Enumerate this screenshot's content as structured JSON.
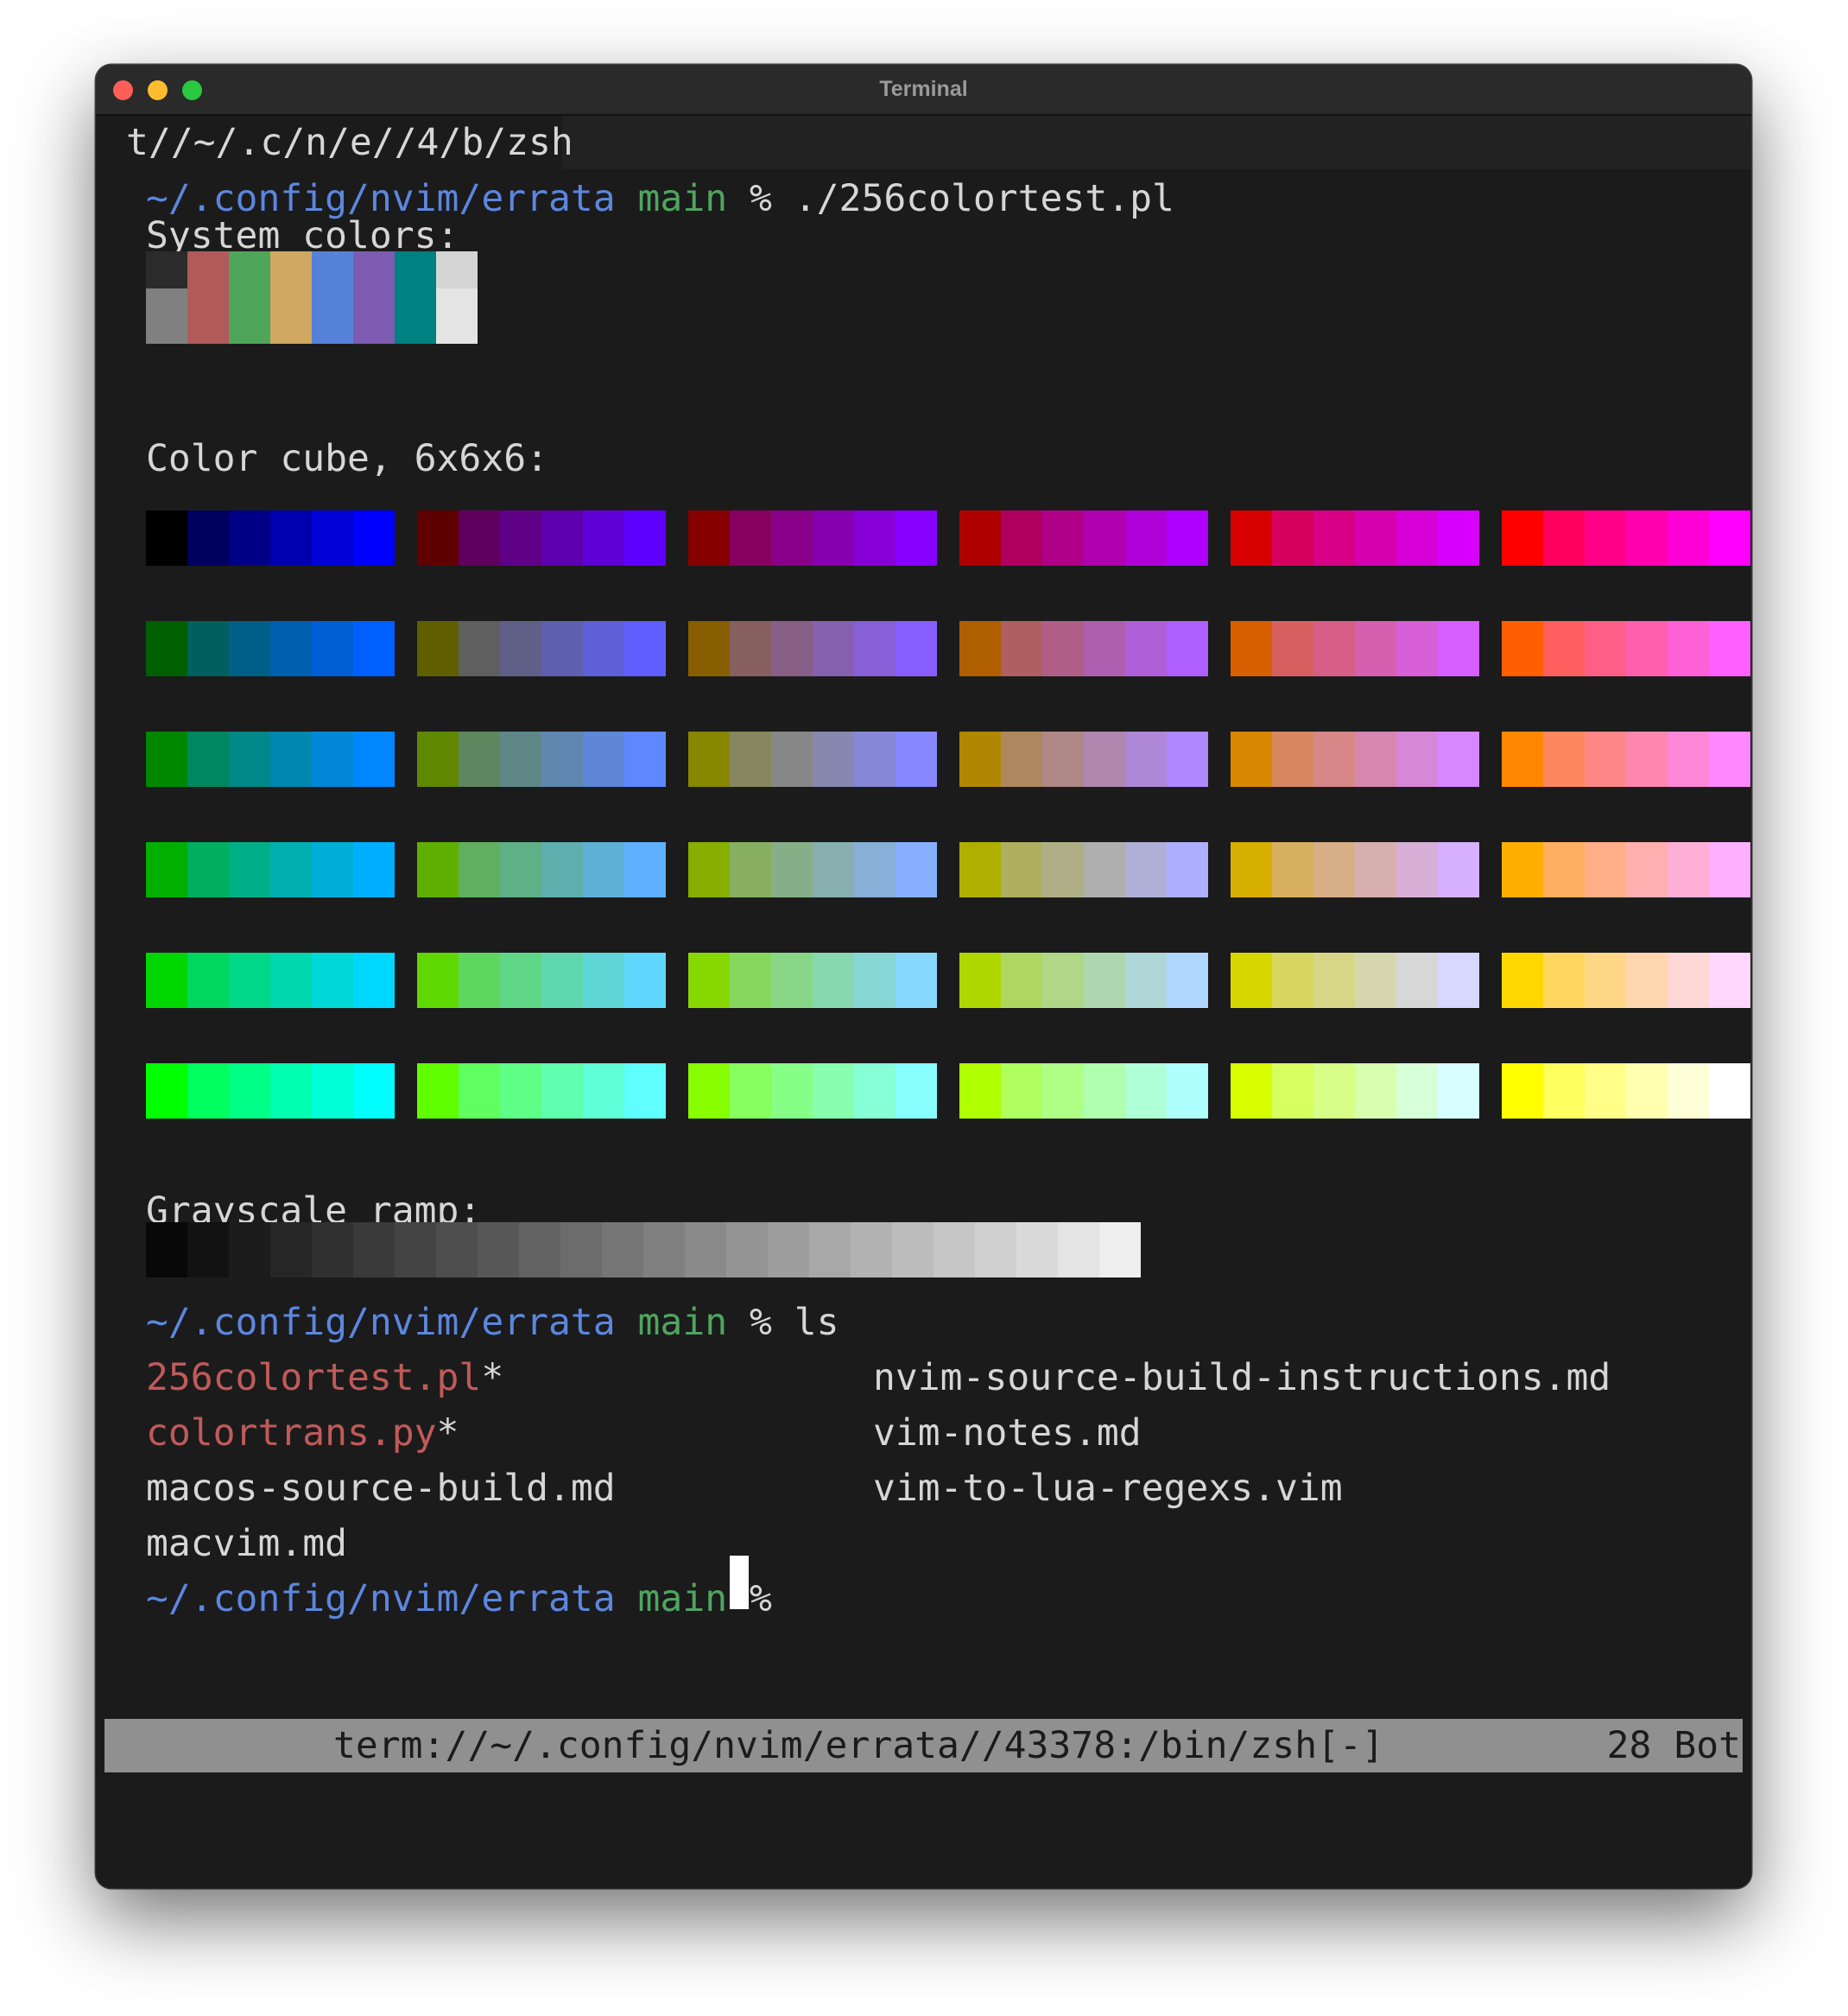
{
  "window": {
    "title": "Terminal"
  },
  "tab": {
    "label": "t//~/.c/n/e//4/b/zsh"
  },
  "prompt": {
    "path": "~/.config/nvim/errata",
    "branch": "main",
    "symbol": "%"
  },
  "commands": {
    "first": "./256colortest.pl",
    "second": "ls"
  },
  "sections": {
    "system": "System colors:",
    "cube": "Color cube, 6x6x6:",
    "gray": "Grayscale ramp:"
  },
  "system_colors": {
    "normal": [
      "#2b2b2b",
      "#b05a5a",
      "#4fa55a",
      "#d0a862",
      "#5582d8",
      "#7d5bb0",
      "#008080",
      "#d4d4d4"
    ],
    "bright": [
      "#808080",
      "#b05a5a",
      "#4fa55a",
      "#d0a862",
      "#5582d8",
      "#7d5bb0",
      "#008080",
      "#e4e4e4"
    ]
  },
  "grayscale": [
    "#080808",
    "#121212",
    "#1c1c1c",
    "#262626",
    "#303030",
    "#3a3a3a",
    "#444444",
    "#4e4e4e",
    "#585858",
    "#626262",
    "#6c6c6c",
    "#767676",
    "#808080",
    "#8a8a8a",
    "#949494",
    "#9e9e9e",
    "#a8a8a8",
    "#b2b2b2",
    "#bcbcbc",
    "#c6c6c6",
    "#d0d0d0",
    "#dadada",
    "#e4e4e4",
    "#eeeeee"
  ],
  "ls": {
    "col1": [
      {
        "name": "256colortest.pl",
        "suffix": "*"
      },
      {
        "name": "colortrans.py",
        "suffix": "*"
      },
      {
        "name": "macos-source-build.md",
        "suffix": ""
      },
      {
        "name": "macvim.md",
        "suffix": ""
      }
    ],
    "col2": [
      "nvim-source-build-instructions.md",
      "vim-notes.md",
      "vim-to-lua-regexs.vim"
    ]
  },
  "statusline": {
    "name": "term://~/.config/nvim/errata//43378:/bin/zsh[-]",
    "position": "28 Bot"
  },
  "colors": {
    "background": "#1b1b1b",
    "path": "#5c86df",
    "branch": "#4fa560",
    "executable": "#c05a5a",
    "text": "#d6d6d6",
    "status_bg": "#909090"
  }
}
